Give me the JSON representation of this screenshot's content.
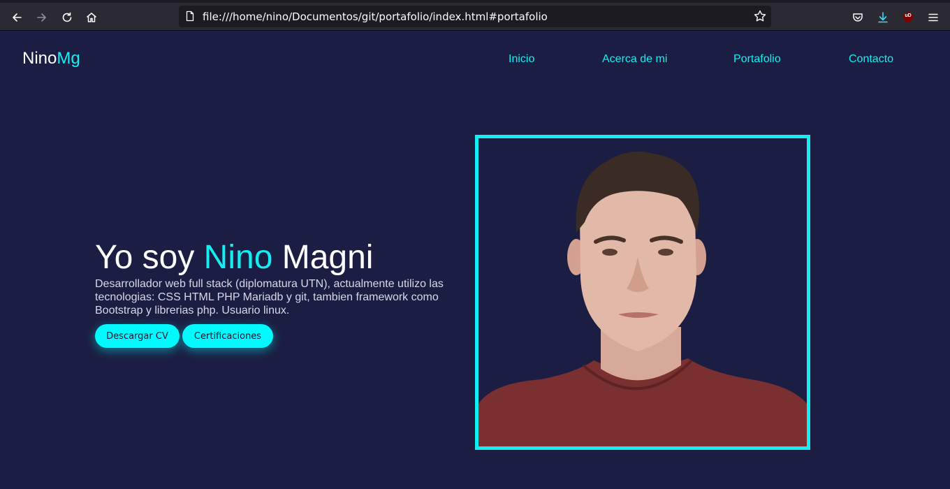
{
  "browser": {
    "url": "file:///home/nino/Documentos/git/portafolio/index.html#portafolio",
    "icons": [
      "back-icon",
      "forward-icon",
      "reload-icon",
      "home-icon",
      "page-icon",
      "bookmark-star-icon",
      "pocket-icon",
      "download-icon",
      "ublock-icon",
      "menu-icon"
    ],
    "ublock_label": "uD"
  },
  "site": {
    "brand_main": "Nino",
    "brand_accent": "Mg",
    "nav": [
      "Inicio",
      "Acerca de mi",
      "Portafolio",
      "Contacto"
    ]
  },
  "hero": {
    "title_pre": "Yo soy ",
    "title_accent": "Nino",
    "title_post": " Magni",
    "description": "Desarrollador web full stack (diplomatura UTN), actualmente utilizo las tecnologias: CSS HTML PHP Mariadb y git, tambien framework como Bootstrap y librerias php. Usuario linux.",
    "buttons": [
      "Descargar CV",
      "Certificaciones"
    ]
  },
  "colors": {
    "background": "#1b1e42",
    "accent": "#14eef2",
    "button": "#00fbff"
  }
}
